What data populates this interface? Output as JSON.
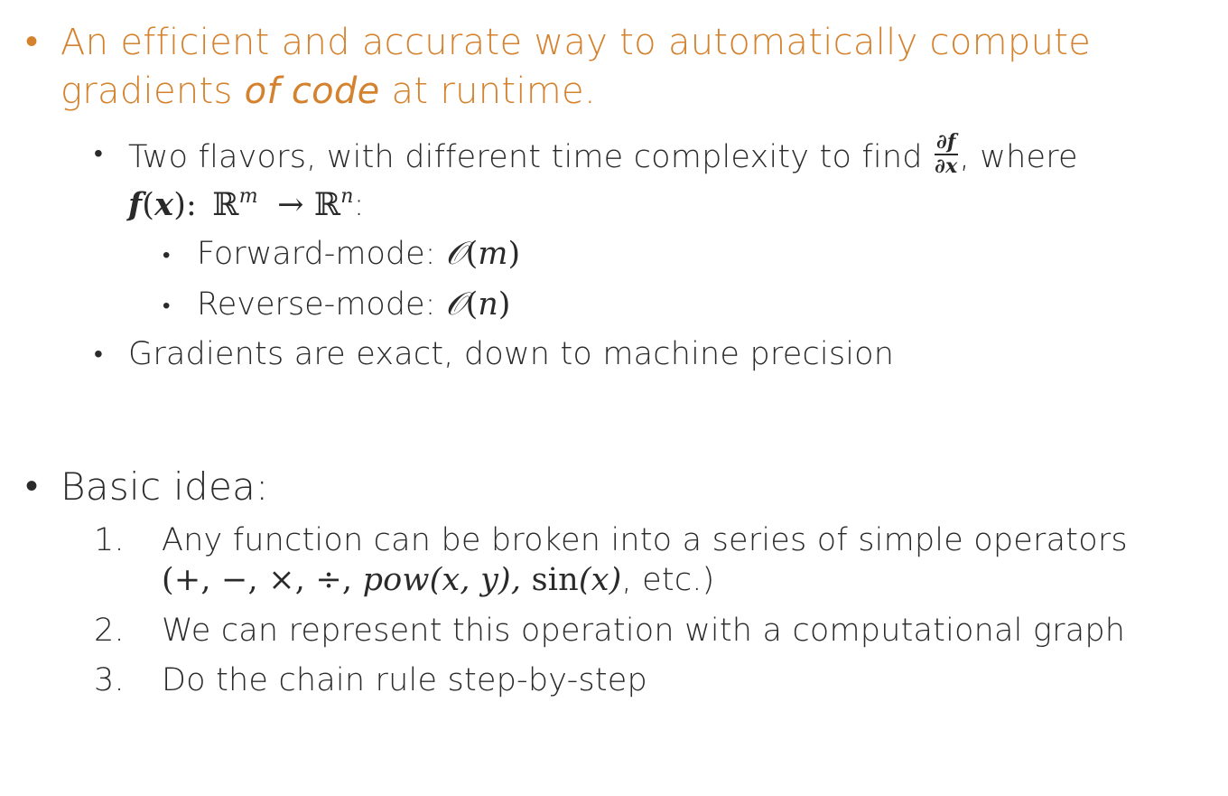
{
  "bullets": {
    "marker": "•"
  },
  "intro": {
    "line1": "An efficient and accurate way to automatically compute",
    "line2_pre": "gradients ",
    "line2_em": "of code",
    "line2_post": " at runtime."
  },
  "flavors": {
    "text_pre": "Two flavors, with different time complexity to find ",
    "frac_num": "∂f",
    "frac_den": "∂x",
    "text_post": ", where",
    "func": "f",
    "func_arg_open": "(",
    "func_arg": "x",
    "func_arg_close": "):",
    "domain_set": "ℝ",
    "domain_exp": "m",
    "arrow": "→",
    "codomain_set": "ℝ",
    "codomain_exp": "n",
    "end_colon": ":",
    "items": [
      {
        "label": "Forward-mode: ",
        "complexity_O": "𝒪",
        "complexity_open": "(",
        "complexity_var": "m",
        "complexity_close": ")"
      },
      {
        "label": "Reverse-mode: ",
        "complexity_O": "𝒪",
        "complexity_open": "(",
        "complexity_var": "n",
        "complexity_close": ")"
      }
    ]
  },
  "exact": {
    "text": "Gradients are exact, down to machine precision"
  },
  "basic": {
    "heading": "Basic idea:",
    "steps": [
      {
        "number": "1.",
        "line1": "Any function can be broken into a series of simple operators",
        "ops_math": "(+,  −,  ×,  ÷,  ",
        "ops_pow": "pow",
        "ops_pow_args": "(x, y),  ",
        "ops_sin": "sin",
        "ops_sin_args": "(x)",
        "ops_tail": ", etc.)"
      },
      {
        "number": "2.",
        "text": "We can represent this operation with a computational graph"
      },
      {
        "number": "3.",
        "text": "Do the chain rule step-by-step"
      }
    ]
  },
  "colors": {
    "accent": "#d4822e",
    "text": "#2a2a2a"
  }
}
